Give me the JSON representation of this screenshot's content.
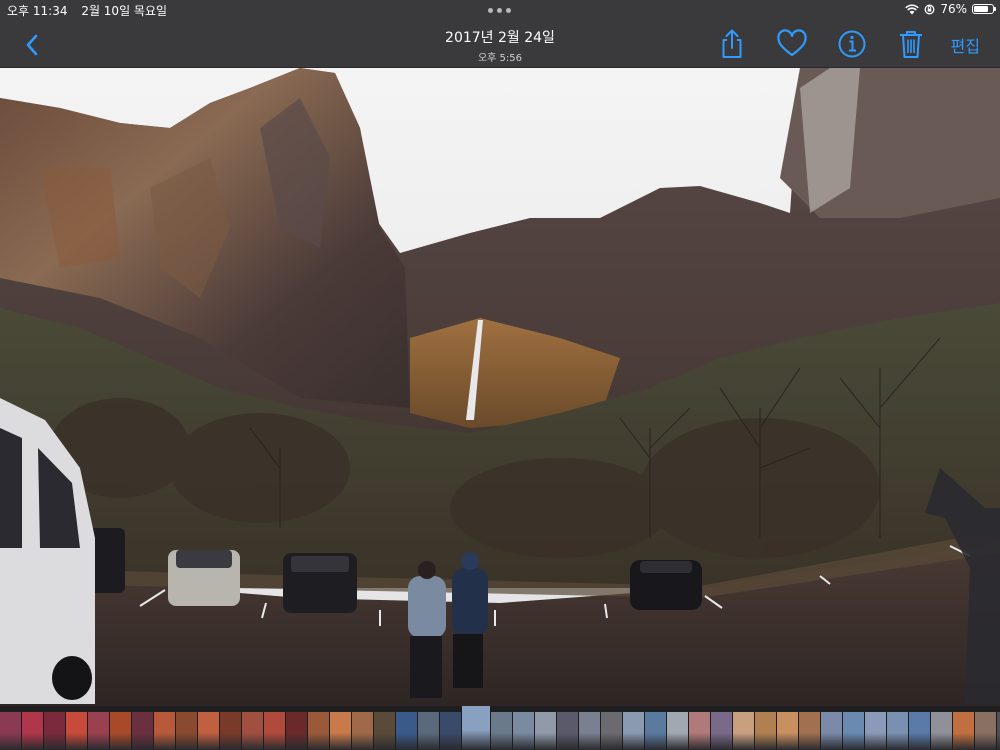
{
  "status_bar": {
    "time": "오후 11:34",
    "date": "2월 10일 목요일",
    "battery_text": "76%",
    "battery_level": 0.76,
    "icons": [
      "wifi-icon",
      "orientation-lock-icon",
      "battery-icon"
    ]
  },
  "nav": {
    "title_date": "2017년 2월 24일",
    "title_time": "오후 5:56",
    "edit_label": "편집",
    "accent_color": "#2f9bff",
    "icons": [
      "back-chevron-icon",
      "share-icon",
      "heart-icon",
      "info-icon",
      "trash-icon"
    ]
  },
  "photo": {
    "subject": "canyon-waterfall-parking-lot"
  },
  "filmstrip": {
    "thumb_colors": [
      "#8a3a52",
      "#b0364a",
      "#7a2a3a",
      "#c84a3a",
      "#9a4050",
      "#a84a2a",
      "#6a3040",
      "#b85a3a",
      "#8a4a30",
      "#c06040",
      "#7a3a2a",
      "#a05040",
      "#b04a3a",
      "#6a2a2a",
      "#9a5a3a",
      "#c87a4a",
      "#a06a4a",
      "#5a4a3a",
      "#3a5a8a",
      "#5a6a7a",
      "#3a4a6a",
      "#8aa0c0",
      "#6a7a8a",
      "#7a8aa0",
      "#909aa8",
      "#5a5a6a",
      "#7a8090",
      "#6a6a70",
      "#8a9ab0",
      "#5a7aa0",
      "#a0a8b0",
      "#b07a7a",
      "#7a6a8a",
      "#c8a080",
      "#b08050",
      "#c89060",
      "#a07050",
      "#7a8aa8",
      "#6a8ab0",
      "#8a9ab8",
      "#7a90b0",
      "#5a7aa8",
      "#909098",
      "#c07040",
      "#8a7060",
      "#505058",
      "#a08070",
      "#6a5a50",
      "#7a6a60",
      "#8a8a90"
    ],
    "current_index": 21
  }
}
